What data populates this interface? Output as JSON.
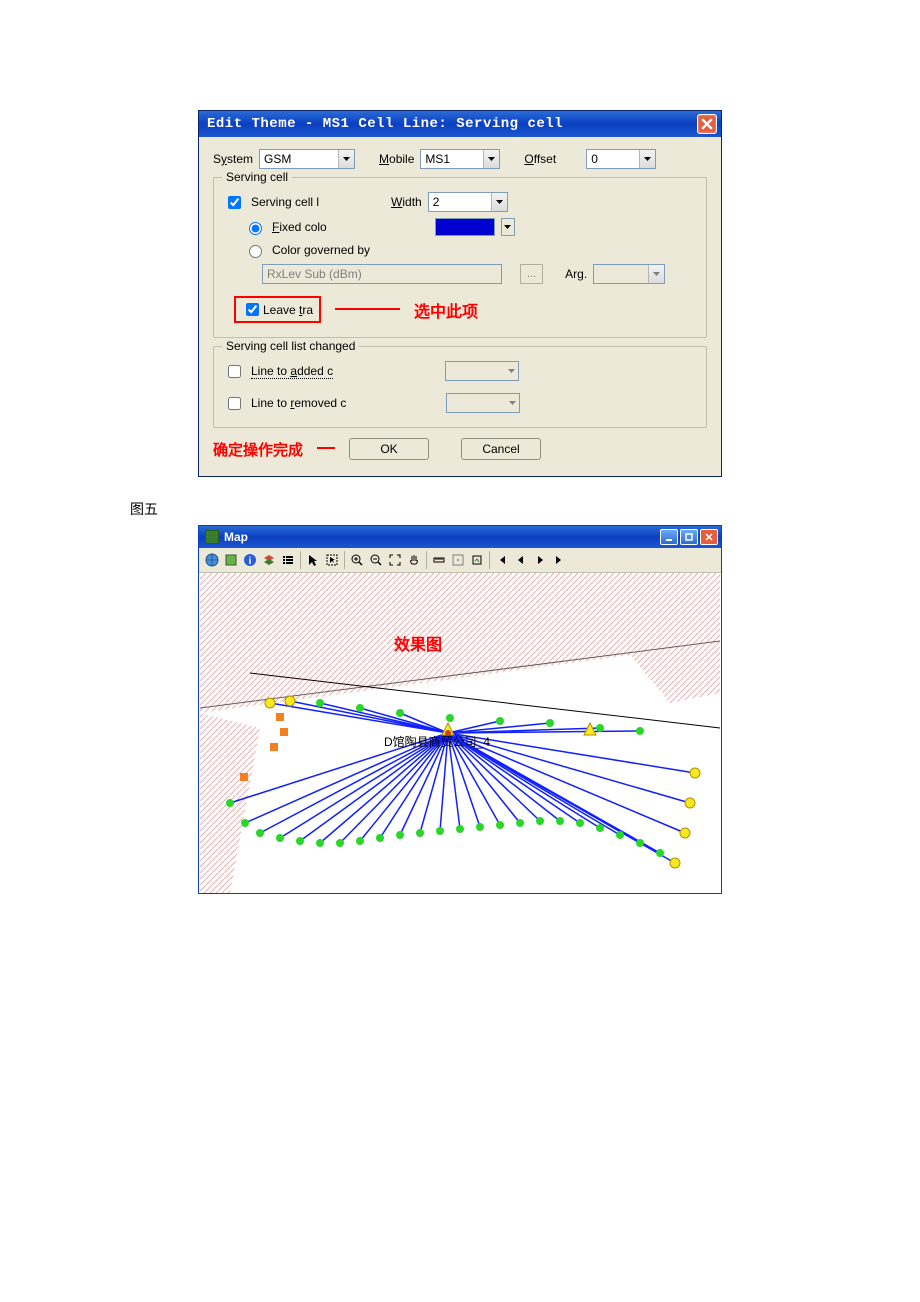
{
  "dialog1": {
    "title": "Edit Theme - MS1 Cell Line:  Serving cell",
    "system": {
      "label_pre": "S",
      "label_u": "y",
      "label_post": "stem",
      "value": "GSM"
    },
    "mobile": {
      "label_pre": "",
      "label_u": "M",
      "label_post": "obile",
      "value": "MS1"
    },
    "offset": {
      "label_pre": "",
      "label_u": "O",
      "label_post": "ffset",
      "value": "0"
    },
    "group_serving": {
      "title": "Serving cell",
      "serving_cell_label": "Serving cell l",
      "width": {
        "label_pre": "",
        "label_u": "W",
        "label_post": "idth",
        "value": "2"
      },
      "fixed_color": {
        "label_pre": "",
        "label_u": "F",
        "label_post": "ixed colo"
      },
      "color_governed": "Color governed by",
      "governed_value": "RxLev Sub (dBm)",
      "ellipsis": "...",
      "arg": {
        "label": "Arg.",
        "value": ""
      },
      "leave_tra": {
        "label_pre": "Leave ",
        "label_u": "t",
        "label_post": "ra"
      },
      "annot_select": "选中此项",
      "color_hex": "#0000d0"
    },
    "group_list": {
      "title": "Serving cell list changed",
      "line_added": {
        "pre": "Line to ",
        "u": "a",
        "post": "dded c"
      },
      "line_removed": {
        "pre": "Line to ",
        "u": "r",
        "post": "emoved c"
      }
    },
    "annot_confirm": "确定操作完成",
    "ok": "OK",
    "cancel": "Cancel"
  },
  "caption": "图五",
  "map": {
    "title": "Map",
    "annot_effect": "效果图",
    "cell_label": "D馆陶县商贸公司_4",
    "toolbar_icons": [
      "globe-icon",
      "map-icon",
      "info-icon",
      "layers-icon",
      "list-icon",
      "pointer-icon",
      "select-icon",
      "zoom-in-icon",
      "zoom-out-icon",
      "zoom-extent-icon",
      "pan-icon",
      "measure-icon",
      "ruler-icon",
      "export-icon",
      "first-icon",
      "prev-icon",
      "next-icon",
      "last-icon"
    ]
  }
}
